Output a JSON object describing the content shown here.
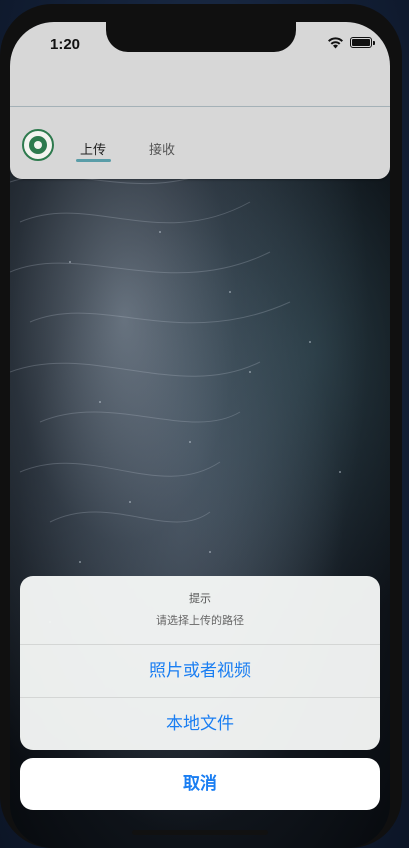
{
  "status_bar": {
    "time": "1:20"
  },
  "tabs": [
    {
      "label": "上传",
      "active": true
    },
    {
      "label": "接收",
      "active": false
    }
  ],
  "action_sheet": {
    "title": "提示",
    "message": "请选择上传的路径",
    "actions": [
      {
        "label": "照片或者视频"
      },
      {
        "label": "本地文件"
      }
    ],
    "cancel_label": "取消"
  },
  "colors": {
    "accent": "#1a7ef2",
    "tab_indicator": "#5a9da8"
  }
}
